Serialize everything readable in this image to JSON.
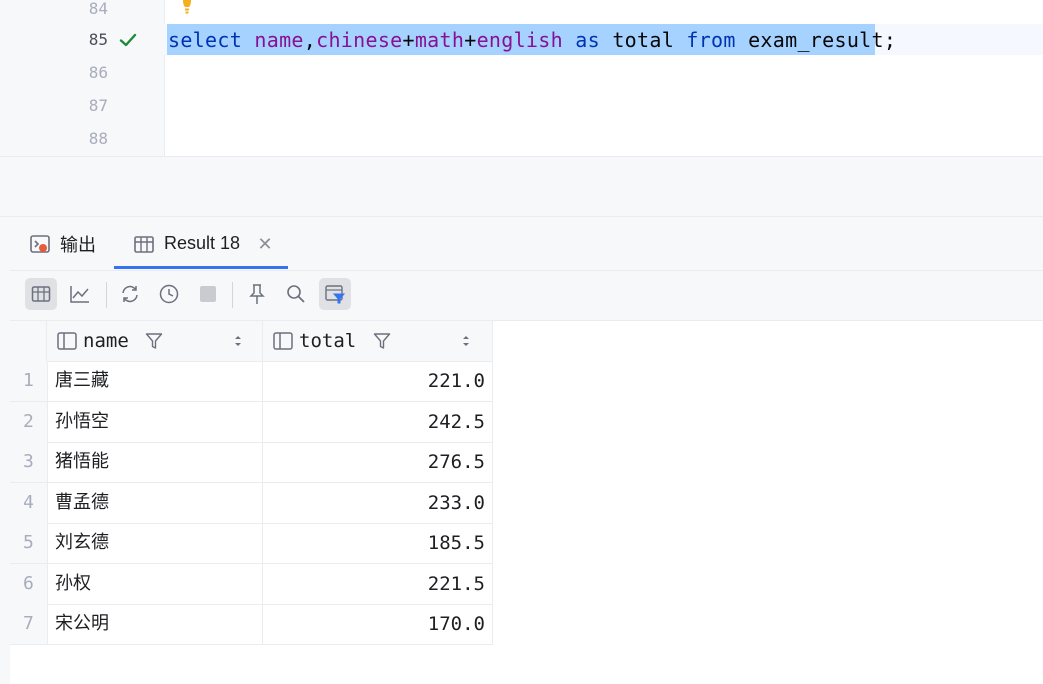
{
  "editor": {
    "line_numbers": [
      "84",
      "85",
      "86",
      "87",
      "88"
    ],
    "active_line": "85",
    "code_tokens": [
      {
        "t": "select",
        "c": "kw"
      },
      {
        "t": " ",
        "c": "plain"
      },
      {
        "t": "name",
        "c": "id"
      },
      {
        "t": ",",
        "c": "plain"
      },
      {
        "t": "chinese",
        "c": "id"
      },
      {
        "t": "+",
        "c": "plain"
      },
      {
        "t": "math",
        "c": "id"
      },
      {
        "t": "+",
        "c": "plain"
      },
      {
        "t": "english",
        "c": "id"
      },
      {
        "t": " ",
        "c": "plain"
      },
      {
        "t": "as",
        "c": "kw"
      },
      {
        "t": " total ",
        "c": "plain"
      },
      {
        "t": "from",
        "c": "kw"
      },
      {
        "t": " exam_result;",
        "c": "plain"
      }
    ],
    "icons": {
      "gutter_status": "check-icon",
      "intention": "lightbulb-icon"
    }
  },
  "tool_window": {
    "tabs": [
      {
        "label": "输出",
        "icon": "output-icon"
      },
      {
        "label": "Result 18",
        "icon": "table-icon",
        "active": true,
        "closable": true
      }
    ],
    "toolbar": [
      "table-view-icon",
      "chart-view-icon",
      "refresh-icon",
      "history-icon",
      "stop-icon",
      "pin-icon",
      "search-icon",
      "filter-settings-icon"
    ]
  },
  "grid": {
    "columns": [
      {
        "label": "name",
        "align": "left"
      },
      {
        "label": "total",
        "align": "right"
      }
    ],
    "rows": [
      {
        "n": "1",
        "name": "唐三藏",
        "total": "221.0"
      },
      {
        "n": "2",
        "name": "孙悟空",
        "total": "242.5"
      },
      {
        "n": "3",
        "name": "猪悟能",
        "total": "276.5"
      },
      {
        "n": "4",
        "name": "曹孟德",
        "total": "233.0"
      },
      {
        "n": "5",
        "name": "刘玄德",
        "total": "185.5"
      },
      {
        "n": "6",
        "name": "孙权",
        "total": "221.5"
      },
      {
        "n": "7",
        "name": "宋公明",
        "total": "170.0"
      }
    ]
  },
  "colors": {
    "selection": "#a6d2ff",
    "keyword": "#0033b3",
    "identifier": "#871094",
    "tab_accent": "#3574f0",
    "check": "#208a3c"
  }
}
